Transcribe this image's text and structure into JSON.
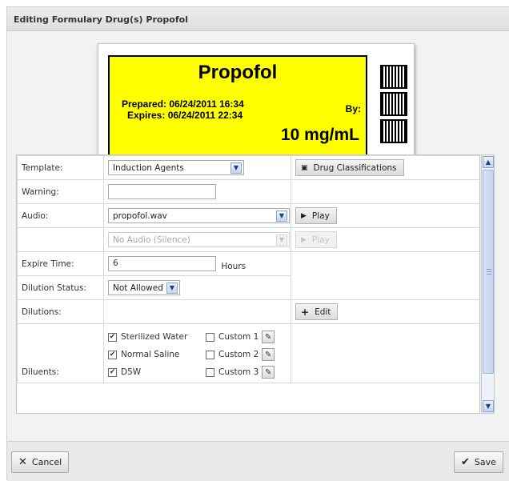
{
  "dialog": {
    "title": "Editing Formulary Drug(s) Propofol"
  },
  "label": {
    "drug_name": "Propofol",
    "prepared": "Prepared: 06/24/2011 16:34",
    "expires": "Expires: 06/24/2011 22:34",
    "by": "By:",
    "concentration": "10 mg/mL",
    "background_color": "#ffff00"
  },
  "form": {
    "template_label": "Template:",
    "template_value": "Induction Agents",
    "drug_classifications_button": "Drug Classifications",
    "warning_label": "Warning:",
    "warning_value": "",
    "audio_label": "Audio:",
    "audio_value": "propofol.wav",
    "play_button": "Play",
    "audio2_value": "No Audio (Silence)",
    "play2_button": "Play",
    "expire_time_label": "Expire Time:",
    "expire_time_value": "6",
    "expire_time_unit": "Hours",
    "dilution_status_label": "Dilution Status:",
    "dilution_status_value": "Not Allowed",
    "dilutions_label": "Dilutions:",
    "edit_button": "Edit",
    "diluents_label": "Diluents:",
    "diluents": [
      {
        "name": "Sterilized Water",
        "checked": true
      },
      {
        "name": "Normal Saline",
        "checked": true
      },
      {
        "name": "D5W",
        "checked": true
      }
    ],
    "custom_diluents": [
      {
        "name": "Custom 1",
        "checked": false
      },
      {
        "name": "Custom 2",
        "checked": false
      },
      {
        "name": "Custom 3",
        "checked": false
      }
    ]
  },
  "footer": {
    "cancel_button": "Cancel",
    "save_button": "Save"
  },
  "icons": {
    "drug_classifications": "image-icon",
    "play": "play-icon",
    "edit": "plus-icon",
    "custom_edit": "pencil-icon",
    "cancel": "x-icon",
    "save": "checkmark-icon"
  }
}
